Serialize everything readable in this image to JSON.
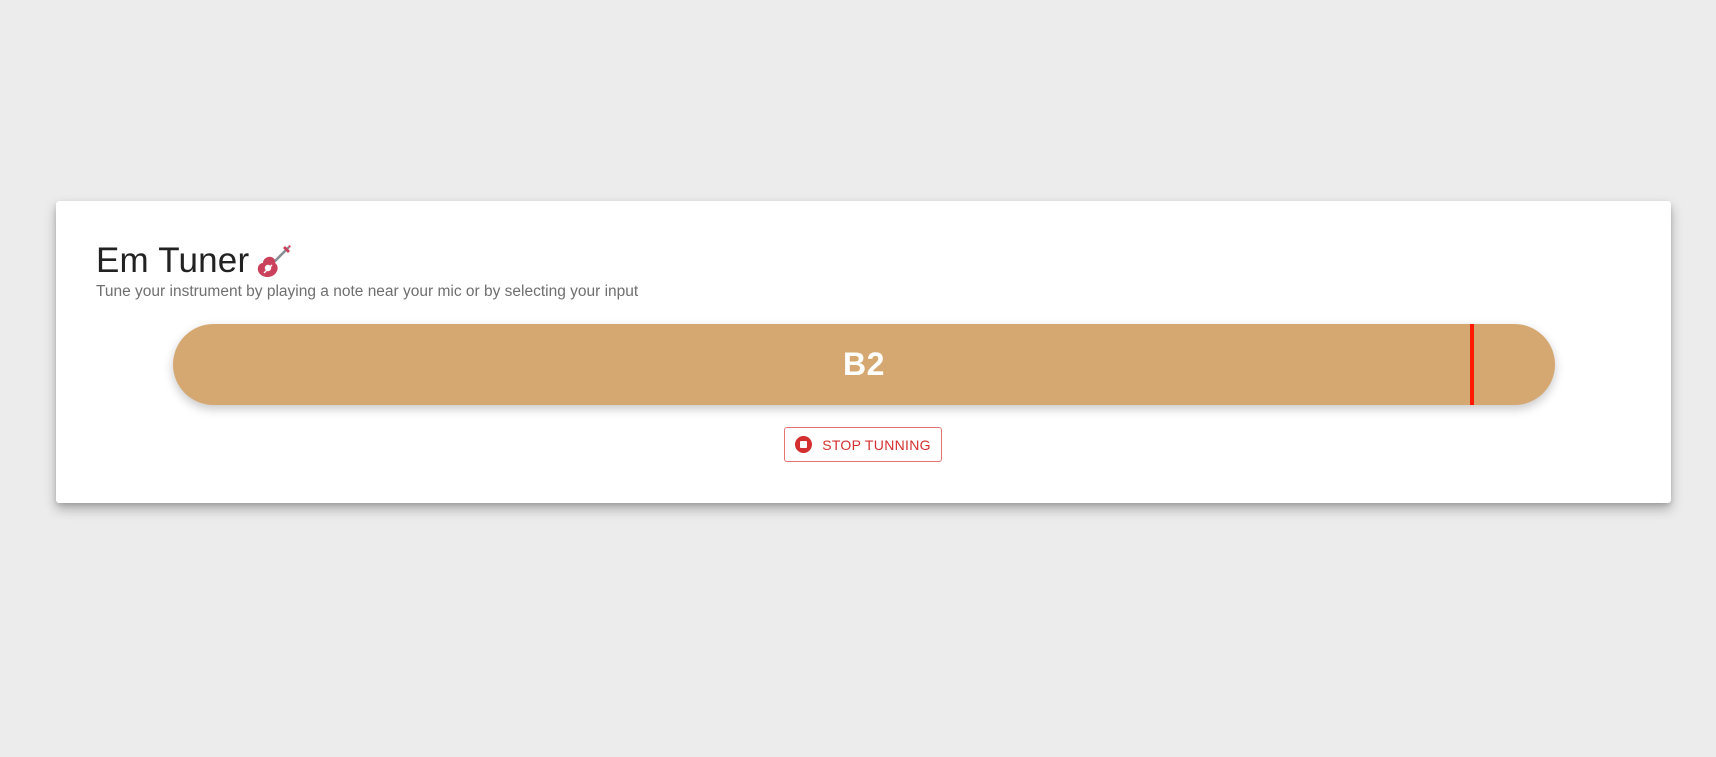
{
  "app": {
    "title": "Em Tuner",
    "title_icon": "guitar-icon",
    "subtitle": "Tune your instrument by playing a note near your mic or by selecting your input"
  },
  "tuner": {
    "note": "B2",
    "needle_position": 0.94,
    "meter_color": "#d6a871",
    "needle_color": "#ff1a00"
  },
  "controls": {
    "stop_label": "STOP TUNNING",
    "stop_icon": "stop-circle-icon",
    "accent_color": "#d32f2f"
  }
}
